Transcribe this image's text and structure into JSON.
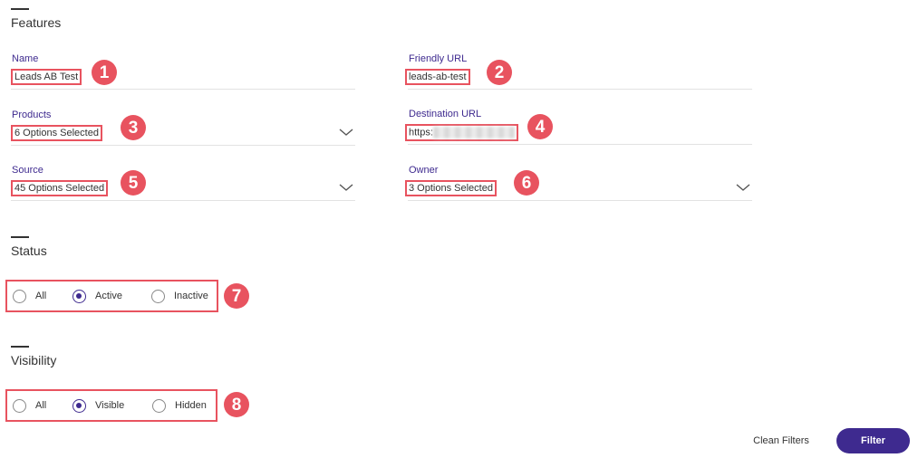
{
  "features": {
    "title": "Features",
    "name": {
      "label": "Name",
      "value": "Leads AB Test",
      "badge": "1"
    },
    "friendly_url": {
      "label": "Friendly URL",
      "value": "leads-ab-test",
      "badge": "2"
    },
    "products": {
      "label": "Products",
      "value": "6 Options Selected",
      "badge": "3"
    },
    "destination_url": {
      "label": "Destination URL",
      "value": "https:",
      "badge": "4"
    },
    "source": {
      "label": "Source",
      "value": "45 Options Selected",
      "badge": "5"
    },
    "owner": {
      "label": "Owner",
      "value": "3 Options Selected",
      "badge": "6"
    }
  },
  "status": {
    "title": "Status",
    "badge": "7",
    "options": [
      {
        "label": "All",
        "checked": false
      },
      {
        "label": "Active",
        "checked": true
      },
      {
        "label": "Inactive",
        "checked": false
      }
    ]
  },
  "visibility": {
    "title": "Visibility",
    "badge": "8",
    "options": [
      {
        "label": "All",
        "checked": false
      },
      {
        "label": "Visible",
        "checked": true
      },
      {
        "label": "Hidden",
        "checked": false
      }
    ]
  },
  "actions": {
    "clean_label": "Clean Filters",
    "filter_label": "Filter"
  },
  "colors": {
    "accent": "#3e2a8f",
    "highlight": "#e8535f"
  },
  "icons": {
    "dropdown": "chevron-down-icon",
    "radio": "radio-icon"
  }
}
